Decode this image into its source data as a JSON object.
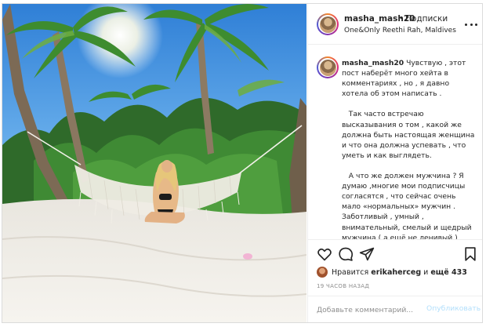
{
  "post": {
    "username": "masha_mash20",
    "separator": "•",
    "follow_status": "Подписки",
    "location": "One&Only Reethi Rah, Maldives",
    "more_icon": "more-horizontal-icon"
  },
  "caption": {
    "username": "masha_mash20",
    "text": " Чувствую , этот пост наберёт много хейта в комментариях , но , я давно хотела об этом написать .\n\n   Так часто встречаю высказывания о том , какой же должна быть настоящая женщина и что она должна успевать , что уметь и как выглядеть.\n\n   А что же должен мужчина ? Я думаю ,многие мои подписчицы согласятся , что сейчас очень мало «нормальных» мужчин . Заботливый , умный , внимательный, смелый и щедрый мужчина ( а ещё не ленивый ) -безумно «редкая птица»"
  },
  "actions": {
    "icons": [
      "heart-icon",
      "comment-icon",
      "share-icon",
      "bookmark-icon"
    ]
  },
  "likes": {
    "prefix": "Нравится",
    "liker": "erikaherceg",
    "conjunction": "и",
    "others": "ещё 433"
  },
  "timestamp": "19 ЧАСОВ НАЗАД",
  "comment": {
    "placeholder": "Добавьте комментарий...",
    "publish_label": "Опубликовать"
  },
  "colors": {
    "border": "#dbdbdb",
    "text": "#262626",
    "muted": "#8e8e8e",
    "publish_disabled": "#b2dffc"
  }
}
